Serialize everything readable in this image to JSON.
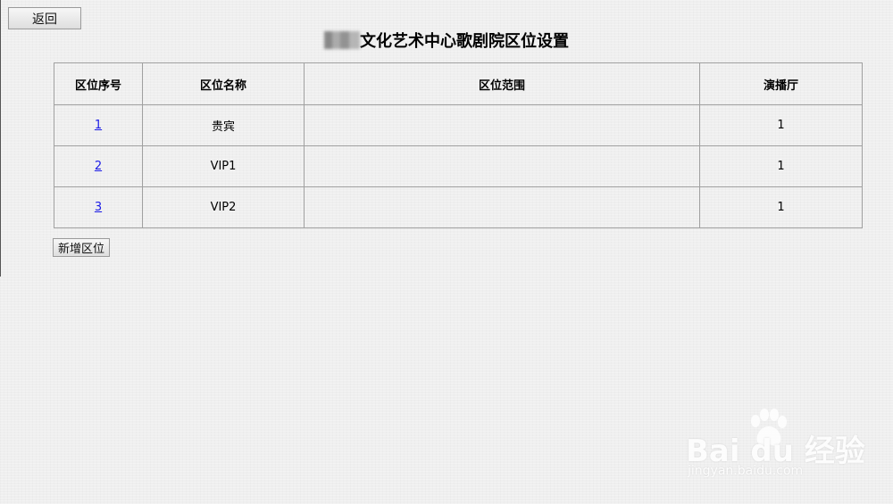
{
  "toolbar": {
    "back_label": "返回"
  },
  "page": {
    "title_suffix": "文化艺术中心歌剧院区位设置"
  },
  "table": {
    "headers": [
      "区位序号",
      "区位名称",
      "区位范围",
      "演播厅"
    ],
    "rows": [
      {
        "id": "1",
        "name": "贵宾",
        "range": "",
        "hall": "1"
      },
      {
        "id": "2",
        "name": "VIP1",
        "range": "",
        "hall": "1"
      },
      {
        "id": "3",
        "name": "VIP2",
        "range": "",
        "hall": "1"
      }
    ]
  },
  "actions": {
    "add_label": "新增区位"
  },
  "watermark": {
    "brand": "Bai du 经验",
    "url": "jingyan.baidu.com"
  },
  "colors": {
    "link": "#1a1ae6",
    "border": "#a0a0a0",
    "background": "#efefef"
  }
}
